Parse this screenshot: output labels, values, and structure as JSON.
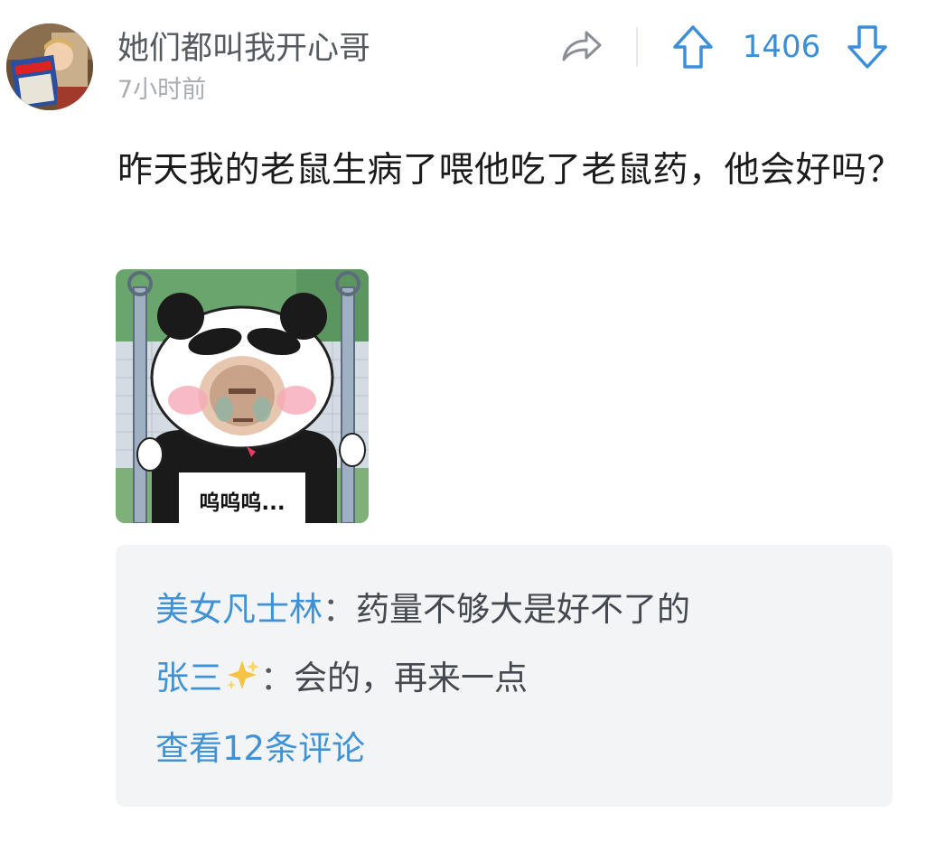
{
  "post": {
    "username": "她们都叫我开心哥",
    "time": "7小时前",
    "votes": "1406",
    "content": "昨天我的老鼠生病了喂他吃了老鼠药，他会好吗？",
    "meme_caption": "呜呜呜..."
  },
  "icons": {
    "share": "share-icon",
    "upvote": "arrow-up-icon",
    "downvote": "arrow-down-icon",
    "sparkle": "sparkles-emoji"
  },
  "comments": {
    "items": [
      {
        "author": "美女凡士林",
        "separator": "：",
        "text": "药量不够大是好不了的"
      },
      {
        "author": "张三",
        "separator": "：",
        "text": "会的，再来一点"
      }
    ],
    "more_label": "查看12条评论"
  },
  "colors": {
    "accent": "#3f92d6",
    "comment_bg": "#f3f4f6",
    "username": "#555a60",
    "time": "#a9adb2"
  }
}
